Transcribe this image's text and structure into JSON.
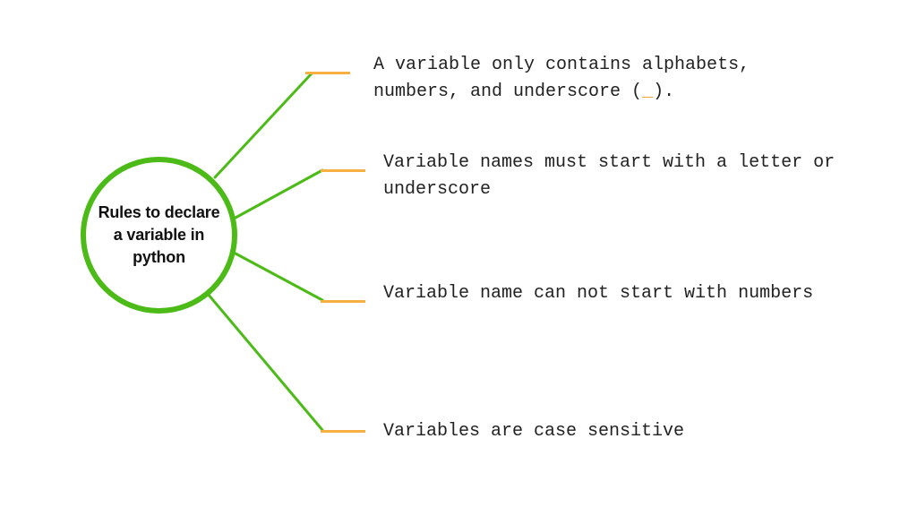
{
  "center": {
    "title": "Rules to declare a variable in python"
  },
  "rules": {
    "r1_pre": "A variable only contains alphabets, numbers, and underscore (",
    "r1_underscore": "_",
    "r1_post": ").",
    "r2": "Variable names must start with a letter or underscore",
    "r3": "Variable name can not start with numbers",
    "r4": "Variables are case sensitive"
  },
  "colors": {
    "green": "#4CBB17",
    "orange": "#F5B041"
  }
}
